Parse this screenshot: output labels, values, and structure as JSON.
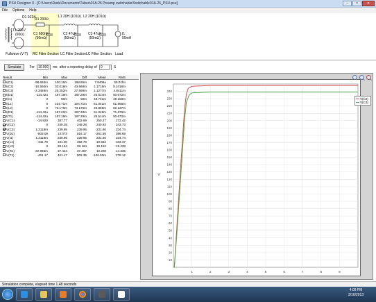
{
  "window": {
    "title": "PSU Designer II - [C:\\Users\\Radu\\Documents\\Tubes\\01A-26 Preamp switchable\\Switchable01A-26_PSU.psu]"
  },
  "menu": [
    "File",
    "Options",
    "Help"
  ],
  "schematic": {
    "labels": {
      "d1": "D1 0Z34",
      "t1": "T1 266V",
      "t1_sub": "(60Ω)",
      "r1": "R1 200Ω",
      "c1": "C1 680nF",
      "c1_sub": "(50mΩ)",
      "l1": "L1 20H (101Ω)",
      "c2": "C2 47uF",
      "c2_sub": "(50mΩ)",
      "l2": "L2 20H (101Ω)",
      "c3": "C3 47uF",
      "c3_sub": "(50mΩ)",
      "i1": "I1",
      "i1_sub": "50mA",
      "fullwave": "Fullwave (V-T)",
      "rc_section": "RC Filter Section",
      "lc1_section": "LC Filter Section",
      "lc2_section": "LC Filter Section",
      "load": "Load"
    }
  },
  "controls": {
    "simulate_label": "Simulate",
    "for_label": "For",
    "duration_value": "10.000",
    "duration_unit": "ms",
    "delay_label": "after a reporting delay of",
    "delay_value": "0",
    "delay_unit": "S"
  },
  "results_table": {
    "headers": [
      "Result",
      "Min",
      "Max",
      "Diff",
      "Mean",
      "RMS"
    ],
    "rows": [
      {
        "name": "I(C1)",
        "checked": false,
        "min": "-98.693m",
        "max": "100.16m",
        "diff": "198.86m",
        "mean": "7.8408u",
        "rms": "56.01fm"
      },
      {
        "name": "I(C2)",
        "checked": false,
        "min": "-10.550m",
        "max": "33.018m",
        "diff": "43.568m",
        "mean": "1.1715m",
        "rms": "8.2416m"
      },
      {
        "name": "I(C3)",
        "checked": false,
        "min": "-2.3469m",
        "max": "25.252m",
        "diff": "27.599m",
        "mean": "1.1277m",
        "rms": "4.8411m"
      },
      {
        "name": "I(D1)",
        "checked": false,
        "min": "-114.42u",
        "max": "187.19m",
        "diff": "187.29m",
        "mean": "25.514m",
        "rms": "50.672m"
      },
      {
        "name": "I(I1)",
        "checked": false,
        "min": "0",
        "max": "50m",
        "diff": "50m",
        "mean": "48.741m",
        "rms": "49.159m"
      },
      {
        "name": "I(L1)",
        "checked": false,
        "min": "0",
        "max": "104.71m",
        "diff": "104.71m",
        "mean": "51.041m",
        "rms": "51.956m"
      },
      {
        "name": "I(L2)",
        "checked": false,
        "min": "0",
        "max": "73.176m",
        "diff": "73.176m",
        "mean": "49.869m",
        "rms": "50.137m"
      },
      {
        "name": "I(R1)",
        "checked": false,
        "min": "-114.42u",
        "max": "187.22m",
        "diff": "187.33m",
        "mean": "51.049m",
        "rms": "71.676m"
      },
      {
        "name": "I(T1)",
        "checked": false,
        "min": "-114.42u",
        "max": "187.19m",
        "diff": "187.29m",
        "mean": "25.514m",
        "rms": "50.672m"
      },
      {
        "name": "V(C1)",
        "checked": false,
        "min": "-14.920",
        "max": "387.77",
        "diff": "402.59",
        "mean": "250.27",
        "rms": "272.42"
      },
      {
        "name": "V(C2)",
        "checked": true,
        "min": "0",
        "max": "249.28",
        "diff": "249.28",
        "mean": "240.92",
        "rms": "243.73"
      },
      {
        "name": "V(C3)",
        "checked": true,
        "min": "1.3118m",
        "max": "239.95",
        "diff": "239.95",
        "mean": "231.60",
        "rms": "234.74"
      },
      {
        "name": "V(D1)",
        "checked": false,
        "min": "-803.09",
        "max": "13.073",
        "diff": "816.17",
        "mean": "-261.55",
        "rms": "398.69"
      },
      {
        "name": "V(I1)",
        "checked": false,
        "min": "1.3118m",
        "max": "239.95",
        "diff": "239.95",
        "mean": "231.60",
        "rms": "234.74"
      },
      {
        "name": "V(L1)",
        "checked": false,
        "min": "-211.70",
        "max": "181.00",
        "diff": "392.70",
        "mean": "19.562",
        "rms": "103.37"
      },
      {
        "name": "V(L2)",
        "checked": false,
        "min": "0",
        "max": "28.164",
        "diff": "28.164",
        "mean": "19.152",
        "rms": "19.228"
      },
      {
        "name": "V(R1)",
        "checked": false,
        "min": "-22.985m",
        "max": "37.444",
        "diff": "37.467",
        "mean": "10.208",
        "rms": "14.335"
      },
      {
        "name": "V(T1)",
        "checked": false,
        "min": "-401.17",
        "max": "401.17",
        "diff": "802.35",
        "mean": "-106.03m",
        "rms": "278.12"
      }
    ]
  },
  "chart_data": {
    "type": "line",
    "ylabel": "V",
    "xlim": [
      0,
      10
    ],
    "ylim": [
      0,
      250
    ],
    "x_ticks": [
      "1",
      "2",
      "3",
      "4",
      "5",
      "6",
      "7",
      "8",
      "9"
    ],
    "y_ticks": [
      "10",
      "20",
      "30",
      "40",
      "50",
      "60",
      "70",
      "80",
      "90",
      "100",
      "110",
      "120",
      "130",
      "140",
      "150",
      "160",
      "170",
      "180",
      "190",
      "200",
      "210",
      "220",
      "230",
      "240"
    ],
    "grid": true,
    "legend_position": "right",
    "series": [
      {
        "name": "V(C2)",
        "color": "#d84a4a",
        "x": [
          0,
          0.05,
          0.2,
          0.4,
          0.6,
          0.7,
          0.8,
          1,
          2,
          4,
          6,
          8,
          10
        ],
        "values": [
          0,
          0,
          60,
          140,
          215,
          236,
          244,
          247,
          248,
          248,
          248,
          248,
          248
        ]
      },
      {
        "name": "V(C3)",
        "color": "#4caa4c",
        "x": [
          0,
          0.05,
          0.2,
          0.4,
          0.6,
          0.7,
          0.85,
          1,
          2,
          4,
          6,
          8,
          10
        ],
        "values": [
          0,
          0,
          50,
          125,
          200,
          225,
          235,
          238,
          239,
          239,
          239,
          239,
          239
        ]
      }
    ]
  },
  "status": {
    "text": "Simulation complete, elapsed time 1.48 seconds"
  },
  "taskbar": {
    "time": "4:09 PM",
    "date": "3/16/2013"
  },
  "colors": {
    "accent": "#c9dcf0",
    "rc_highlight": "#ffffcc"
  }
}
